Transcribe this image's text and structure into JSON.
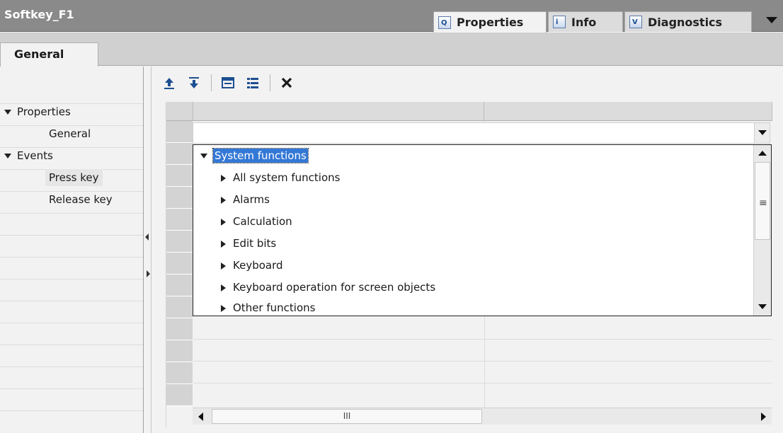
{
  "window": {
    "title": "Softkey_F1",
    "tabs": [
      {
        "label": "Properties",
        "icon": "properties-icon",
        "active": true
      },
      {
        "label": "Info",
        "icon": "info-icon",
        "active": false
      },
      {
        "label": "Diagnostics",
        "icon": "diagnostics-icon",
        "active": false
      }
    ]
  },
  "subtabs": {
    "general": "General"
  },
  "nav": {
    "groups": [
      {
        "label": "Properties",
        "items": [
          "General"
        ]
      },
      {
        "label": "Events",
        "items": [
          "Press key",
          "Release key"
        ]
      }
    ],
    "selected": "Press key"
  },
  "toolbar": {
    "buttons": [
      "move-up-icon",
      "move-down-icon",
      "insert-icon",
      "list-icon",
      "delete-icon"
    ]
  },
  "tree": {
    "root": "System functions",
    "items": [
      "All system functions",
      "Alarms",
      "Calculation",
      "Edit bits",
      "Keyboard",
      "Keyboard operation for screen objects",
      "Other functions"
    ]
  },
  "scroll": {
    "hgrip": "III",
    "vgrip": "≡"
  },
  "colors": {
    "titlebar": "#8a8a8a",
    "selection": "#3478d6",
    "panel": "#f2f2f2"
  }
}
